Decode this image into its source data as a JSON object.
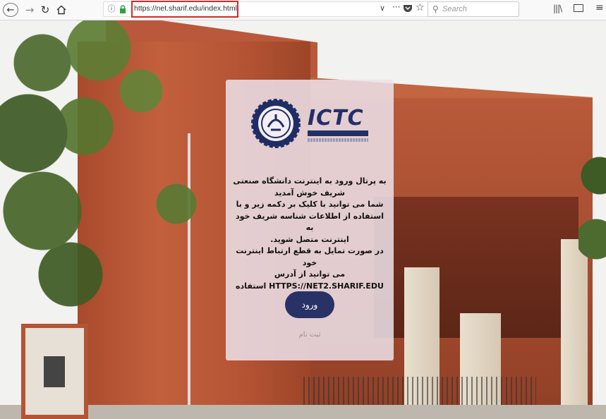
{
  "browser": {
    "url": "https://net.sharif.edu/index.html",
    "search_placeholder": "Search"
  },
  "icons": {
    "back": "arrow-left-icon",
    "forward": "arrow-right-icon",
    "reload": "reload-icon",
    "home": "home-icon",
    "info": "info-icon",
    "lock": "lock-icon",
    "dropdown": "chevron-down-icon",
    "more": "ellipsis-icon",
    "pocket": "pocket-icon",
    "bookmark": "star-icon",
    "search": "search-icon",
    "library": "library-icon",
    "sidebar": "sidebar-icon",
    "menu": "hamburger-menu-icon"
  },
  "colors": {
    "url_highlight": "#d42a2a",
    "brand_navy": "#283266",
    "card_bg": "#ece2ea"
  },
  "card": {
    "logo_text": "ICTC",
    "welcome_lines": [
      "به پرتال ورود به اینترنت دانشگاه صنعتی",
      "شریف خوش آمدید",
      "شما می توانید با کلیک بر دکمه زیر و با",
      "استفاده از اطلاعات شناسه شریف خود به",
      "اینترنت متصل شوید.",
      "در صورت تمایل به قطع ارتباط اینترنت خود",
      "می توانید از آدرس",
      "HTTPS://NET2.SHARIF.EDU استفاده کنید."
    ],
    "login_label": "ورود",
    "register_label": "ثبت نام"
  }
}
